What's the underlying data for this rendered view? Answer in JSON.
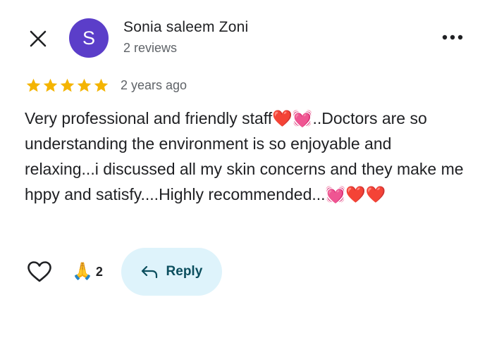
{
  "reviewer": {
    "avatar_initial": "S",
    "avatar_color": "#5b3ec9",
    "name": "Sonia saleem Zoni",
    "meta": "2 reviews"
  },
  "rating": {
    "stars": 5,
    "max_stars": 5,
    "star_color": "#f4b400",
    "time_ago": "2 years ago"
  },
  "review": {
    "text": "Very professional and friendly staff❤️💓..Doctors are so understanding the environment is so enjoyable and relaxing...i discussed all my skin concerns and they make me hppy and satisfy....Highly recommended...💓❤️❤️"
  },
  "actions": {
    "like_icon": "heart-outline-icon",
    "reaction_emoji": "🙏",
    "reaction_count": "2",
    "reply_icon": "reply-arrow-icon",
    "reply_label": "Reply",
    "reply_bg": "#def3fb"
  },
  "icons": {
    "close": "close-icon",
    "more": "more-options-icon"
  }
}
